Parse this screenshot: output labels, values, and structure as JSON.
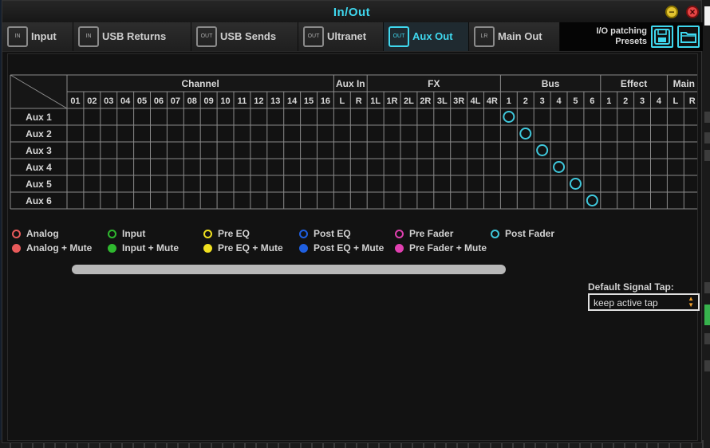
{
  "window": {
    "title": "In/Out",
    "minimize_symbol": "−",
    "close_symbol": "×"
  },
  "tabs": [
    {
      "label": "Input",
      "icon": "IN",
      "active": false
    },
    {
      "label": "USB Returns",
      "icon": "IN",
      "active": false
    },
    {
      "label": "USB Sends",
      "icon": "OUT",
      "active": false
    },
    {
      "label": "Ultranet",
      "icon": "OUT",
      "active": false
    },
    {
      "label": "Aux Out",
      "icon": "OUT",
      "active": true
    },
    {
      "label": "Main Out",
      "icon": "LR",
      "active": false
    }
  ],
  "presets": {
    "label_line1": "I/O patching",
    "label_line2": "Presets",
    "save_icon": "floppy-disk-icon",
    "open_icon": "folder-icon"
  },
  "matrix": {
    "groups": [
      {
        "label": "Channel",
        "columns": [
          "01",
          "02",
          "03",
          "04",
          "05",
          "06",
          "07",
          "08",
          "09",
          "10",
          "11",
          "12",
          "13",
          "14",
          "15",
          "16"
        ]
      },
      {
        "label": "Aux In",
        "columns": [
          "L",
          "R"
        ]
      },
      {
        "label": "FX",
        "columns": [
          "1L",
          "1R",
          "2L",
          "2R",
          "3L",
          "3R",
          "4L",
          "4R"
        ]
      },
      {
        "label": "Bus",
        "columns": [
          "1",
          "2",
          "3",
          "4",
          "5",
          "6"
        ]
      },
      {
        "label": "Effect",
        "columns": [
          "1",
          "2",
          "3",
          "4"
        ]
      },
      {
        "label": "Main",
        "columns": [
          "L",
          "R"
        ]
      }
    ],
    "rows": [
      "Aux 1",
      "Aux 2",
      "Aux 3",
      "Aux 4",
      "Aux 5",
      "Aux 6"
    ],
    "patches": [
      {
        "row": 0,
        "group": "Bus",
        "column": "1",
        "tap": "Post Fader"
      },
      {
        "row": 1,
        "group": "Bus",
        "column": "2",
        "tap": "Post Fader"
      },
      {
        "row": 2,
        "group": "Bus",
        "column": "3",
        "tap": "Post Fader"
      },
      {
        "row": 3,
        "group": "Bus",
        "column": "4",
        "tap": "Post Fader"
      },
      {
        "row": 4,
        "group": "Bus",
        "column": "5",
        "tap": "Post Fader"
      },
      {
        "row": 5,
        "group": "Bus",
        "column": "6",
        "tap": "Post Fader"
      }
    ]
  },
  "legend": [
    {
      "label": "Analog",
      "color": "#e85a5a",
      "filled": false
    },
    {
      "label": "Analog + Mute",
      "color": "#e85a5a",
      "filled": true
    },
    {
      "label": "Input",
      "color": "#2fb82f",
      "filled": false
    },
    {
      "label": "Input + Mute",
      "color": "#2fb82f",
      "filled": true
    },
    {
      "label": "Pre EQ",
      "color": "#f0e020",
      "filled": false
    },
    {
      "label": "Pre EQ + Mute",
      "color": "#f0e020",
      "filled": true
    },
    {
      "label": "Post EQ",
      "color": "#1f5fe0",
      "filled": false
    },
    {
      "label": "Post EQ + Mute",
      "color": "#1f5fe0",
      "filled": true
    },
    {
      "label": "Pre Fader",
      "color": "#e040b0",
      "filled": false
    },
    {
      "label": "Pre Fader + Mute",
      "color": "#e040b0",
      "filled": true
    },
    {
      "label": "Post Fader",
      "color": "#3fc8dc",
      "filled": false
    }
  ],
  "signal_tap": {
    "label": "Default Signal Tap:",
    "value": "keep active tap"
  }
}
